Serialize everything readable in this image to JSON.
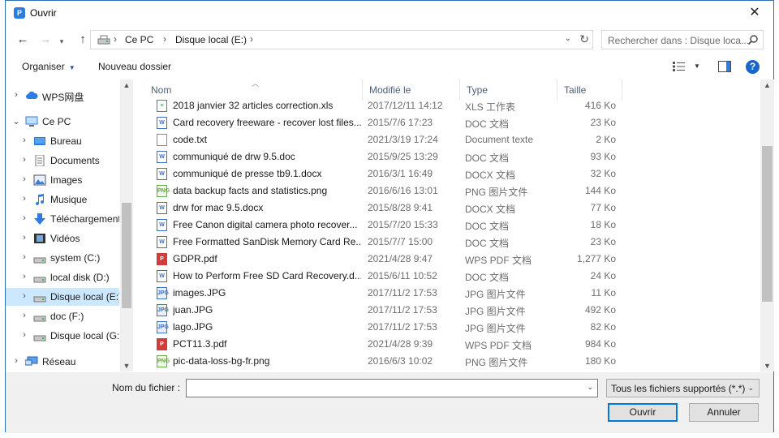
{
  "window": {
    "title": "Ouvrir",
    "app_icon_letter": "P"
  },
  "nav": {
    "back_icon": "arrow-left-icon",
    "forward_icon": "arrow-right-icon",
    "up_icon": "arrow-up-icon"
  },
  "address": {
    "crumbs": [
      "Ce PC",
      "Disque local (E:)"
    ],
    "separator": "›"
  },
  "search": {
    "placeholder": "Rechercher dans : Disque loca..."
  },
  "toolbar": {
    "organize": "Organiser",
    "new_folder": "Nouveau dossier"
  },
  "sidebar": {
    "items": [
      {
        "label": "WPS网盘",
        "icon": "cloud-icon",
        "indent": 0
      },
      {
        "label": "Ce PC",
        "icon": "computer-icon",
        "indent": 0,
        "expanded": true
      },
      {
        "label": "Bureau",
        "icon": "desktop-icon",
        "indent": 1
      },
      {
        "label": "Documents",
        "icon": "documents-icon",
        "indent": 1
      },
      {
        "label": "Images",
        "icon": "pictures-icon",
        "indent": 1
      },
      {
        "label": "Musique",
        "icon": "music-icon",
        "indent": 1
      },
      {
        "label": "Téléchargement",
        "icon": "download-icon",
        "indent": 1
      },
      {
        "label": "Vidéos",
        "icon": "videos-icon",
        "indent": 1
      },
      {
        "label": "system (C:)",
        "icon": "drive-icon",
        "indent": 1
      },
      {
        "label": "local disk (D:)",
        "icon": "drive-icon",
        "indent": 1
      },
      {
        "label": "Disque local (E:)",
        "icon": "drive-icon",
        "indent": 1,
        "selected": true
      },
      {
        "label": "doc (F:)",
        "icon": "drive-icon",
        "indent": 1
      },
      {
        "label": "Disque local (G:)",
        "icon": "drive-icon",
        "indent": 1
      },
      {
        "label": "Réseau",
        "icon": "network-icon",
        "indent": 0
      }
    ]
  },
  "columns": {
    "name": "Nom",
    "modified": "Modifié le",
    "type": "Type",
    "size": "Taille"
  },
  "files": [
    {
      "name": "2018 janvier 32 articles correction.xls",
      "modified": "2017/12/11 14:12",
      "type": "XLS 工作表",
      "size": "416 Ko",
      "kind": "xls"
    },
    {
      "name": "Card recovery freeware - recover lost files...",
      "modified": "2015/7/6 17:23",
      "type": "DOC 文档",
      "size": "23 Ko",
      "kind": "doc"
    },
    {
      "name": "code.txt",
      "modified": "2021/3/19 17:24",
      "type": "Document texte",
      "size": "2 Ko",
      "kind": "txt"
    },
    {
      "name": "communiqué de drw 9.5.doc",
      "modified": "2015/9/25 13:29",
      "type": "DOC 文档",
      "size": "93 Ko",
      "kind": "doc"
    },
    {
      "name": "communiqué de presse tb9.1.docx",
      "modified": "2016/3/1 16:49",
      "type": "DOCX 文档",
      "size": "32 Ko",
      "kind": "doc"
    },
    {
      "name": "data backup facts and statistics.png",
      "modified": "2016/6/16 13:01",
      "type": "PNG 图片文件",
      "size": "144 Ko",
      "kind": "png"
    },
    {
      "name": "drw for mac 9.5.docx",
      "modified": "2015/8/28 9:41",
      "type": "DOCX 文档",
      "size": "77 Ko",
      "kind": "doc"
    },
    {
      "name": "Free Canon digital camera photo recover...",
      "modified": "2015/7/20 15:33",
      "type": "DOC 文档",
      "size": "18 Ko",
      "kind": "doc"
    },
    {
      "name": "Free Formatted SanDisk Memory Card Re...",
      "modified": "2015/7/7 15:00",
      "type": "DOC 文档",
      "size": "23 Ko",
      "kind": "doc"
    },
    {
      "name": "GDPR.pdf",
      "modified": "2021/4/28 9:47",
      "type": "WPS PDF 文档",
      "size": "1,277 Ko",
      "kind": "pdf"
    },
    {
      "name": "How to Perform Free SD Card Recovery.d...",
      "modified": "2015/6/11 10:52",
      "type": "DOC 文档",
      "size": "24 Ko",
      "kind": "doc"
    },
    {
      "name": "images.JPG",
      "modified": "2017/11/2 17:53",
      "type": "JPG 图片文件",
      "size": "11 Ko",
      "kind": "jpg"
    },
    {
      "name": "juan.JPG",
      "modified": "2017/11/2 17:53",
      "type": "JPG 图片文件",
      "size": "492 Ko",
      "kind": "jpg"
    },
    {
      "name": "lago.JPG",
      "modified": "2017/11/2 17:53",
      "type": "JPG 图片文件",
      "size": "82 Ko",
      "kind": "jpg"
    },
    {
      "name": "PCT11.3.pdf",
      "modified": "2021/4/28 9:39",
      "type": "WPS PDF 文档",
      "size": "984 Ko",
      "kind": "pdf"
    },
    {
      "name": "pic-data-loss-bg-fr.png",
      "modified": "2016/6/3 10:02",
      "type": "PNG 图片文件",
      "size": "180 Ko",
      "kind": "png"
    }
  ],
  "footer": {
    "filename_label": "Nom du fichier :",
    "filename_value": "",
    "filter_value": "Tous les fichiers supportés (*.*)",
    "open_label": "Ouvrir",
    "cancel_label": "Annuler"
  },
  "colors": {
    "accent": "#0078d7",
    "selected_bg": "#cce8ff",
    "window_border": "#2b6fb5"
  }
}
